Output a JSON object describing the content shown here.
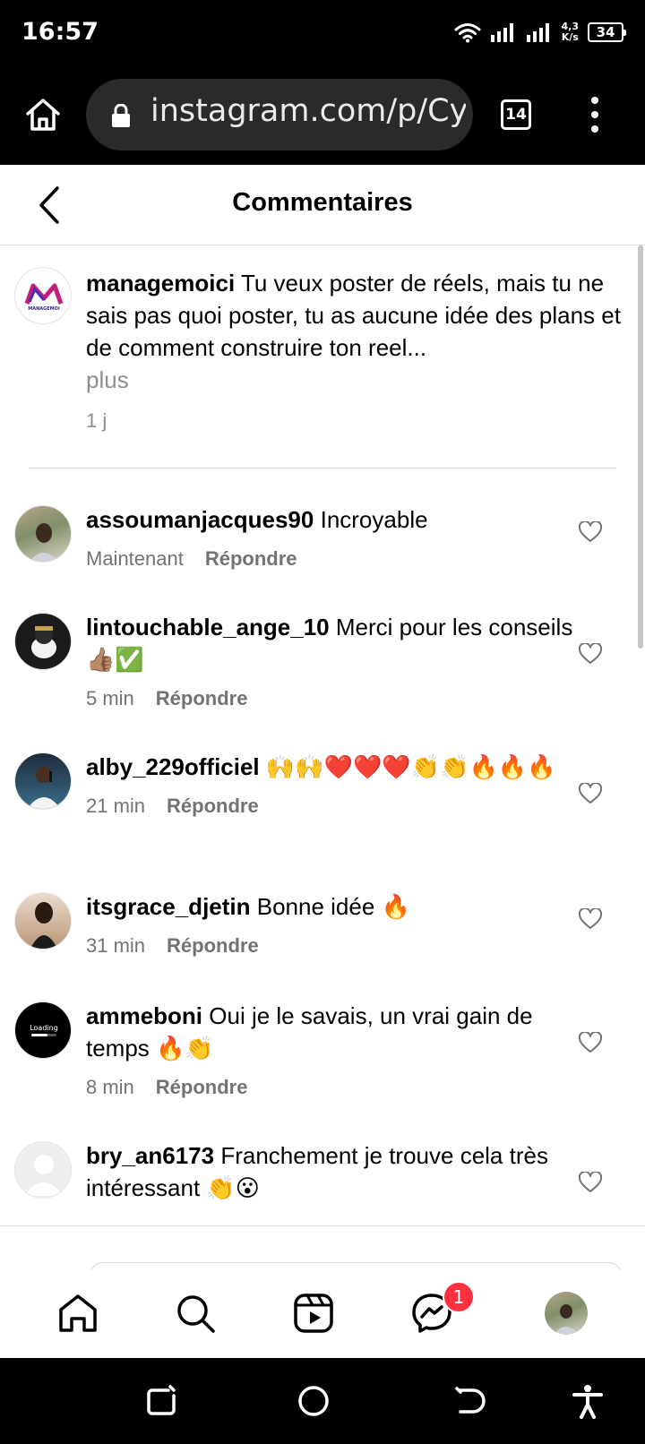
{
  "status_bar": {
    "time": "16:57",
    "speed_value": "4,3",
    "speed_unit": "K/s",
    "battery": "34"
  },
  "browser": {
    "url": "instagram.com/p/Cy",
    "tab_count": "14"
  },
  "header": {
    "title": "Commentaires"
  },
  "caption": {
    "avatar_text": "MANAGEMOI",
    "username": "managemoici",
    "text": "Tu veux poster de réels, mais tu ne sais pas quoi poster, tu as aucune idée des plans et de comment construire ton reel...",
    "more_label": "plus",
    "time": "1 j"
  },
  "reply_label": "Répondre",
  "comments": [
    {
      "username": "assoumanjacques90",
      "text": "Incroyable",
      "time": "Maintenant"
    },
    {
      "username": "lintouchable_ange_10",
      "text": "Merci pour les conseils 👍🏽✅",
      "time": "5 min"
    },
    {
      "username": "alby_229officiel",
      "text": "🙌🙌❤️❤️❤️👏👏🔥🔥🔥",
      "time": "21 min"
    },
    {
      "username": "itsgrace_djetin",
      "text": "Bonne idée 🔥",
      "time": "31 min"
    },
    {
      "username": "ammeboni",
      "text": "Oui je le savais, un vrai gain de temps 🔥👏",
      "time": "8 min",
      "avatar_text": "Loading"
    },
    {
      "username": "bry_an6173",
      "text": "Franchement je trouve cela très intéressant 👏😮"
    }
  ],
  "nav": {
    "messages_badge": "1"
  },
  "icons": [
    "home-icon",
    "lock-icon",
    "tabs-icon",
    "more-vert-icon",
    "back-icon",
    "heart-icon",
    "search-icon",
    "reels-icon",
    "messenger-icon",
    "accessibility-icon"
  ],
  "colors": {
    "badge": "#ff3040",
    "muted_text": "#737373",
    "divider": "#dbdbdb"
  }
}
